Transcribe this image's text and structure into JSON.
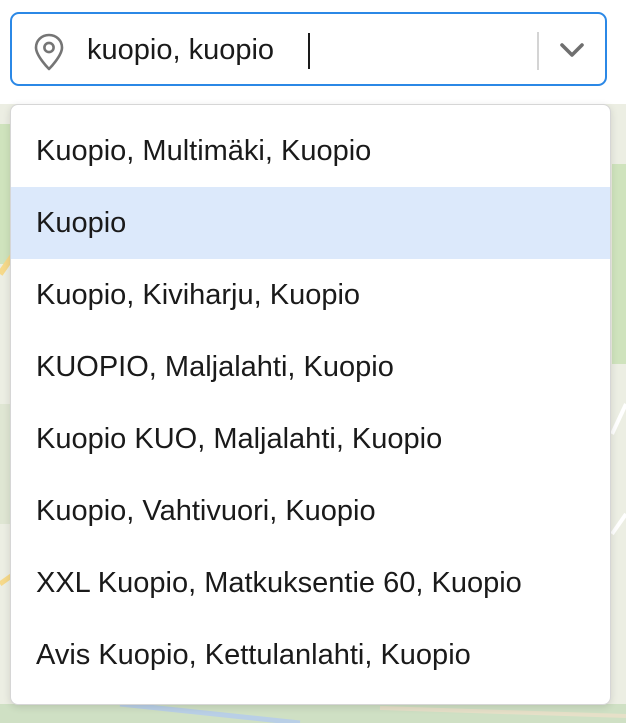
{
  "search": {
    "value": "kuopio, kuopio",
    "icon": "map-pin-icon",
    "toggle_icon": "chevron-down-icon"
  },
  "suggestions": {
    "highlighted_index": 1,
    "items": [
      {
        "label": "Kuopio, Multimäki, Kuopio"
      },
      {
        "label": "Kuopio"
      },
      {
        "label": "Kuopio, Kiviharju, Kuopio"
      },
      {
        "label": "KUOPIO, Maljalahti, Kuopio"
      },
      {
        "label": "Kuopio KUO, Maljalahti, Kuopio"
      },
      {
        "label": "Kuopio, Vahtivuori, Kuopio"
      },
      {
        "label": "XXL Kuopio, Matkuksentie 60, Kuopio"
      },
      {
        "label": "Avis Kuopio, Kettulanlahti, Kuopio"
      }
    ]
  },
  "colors": {
    "focus_border": "#2b88e6",
    "highlight_bg": "#dce9fb"
  }
}
